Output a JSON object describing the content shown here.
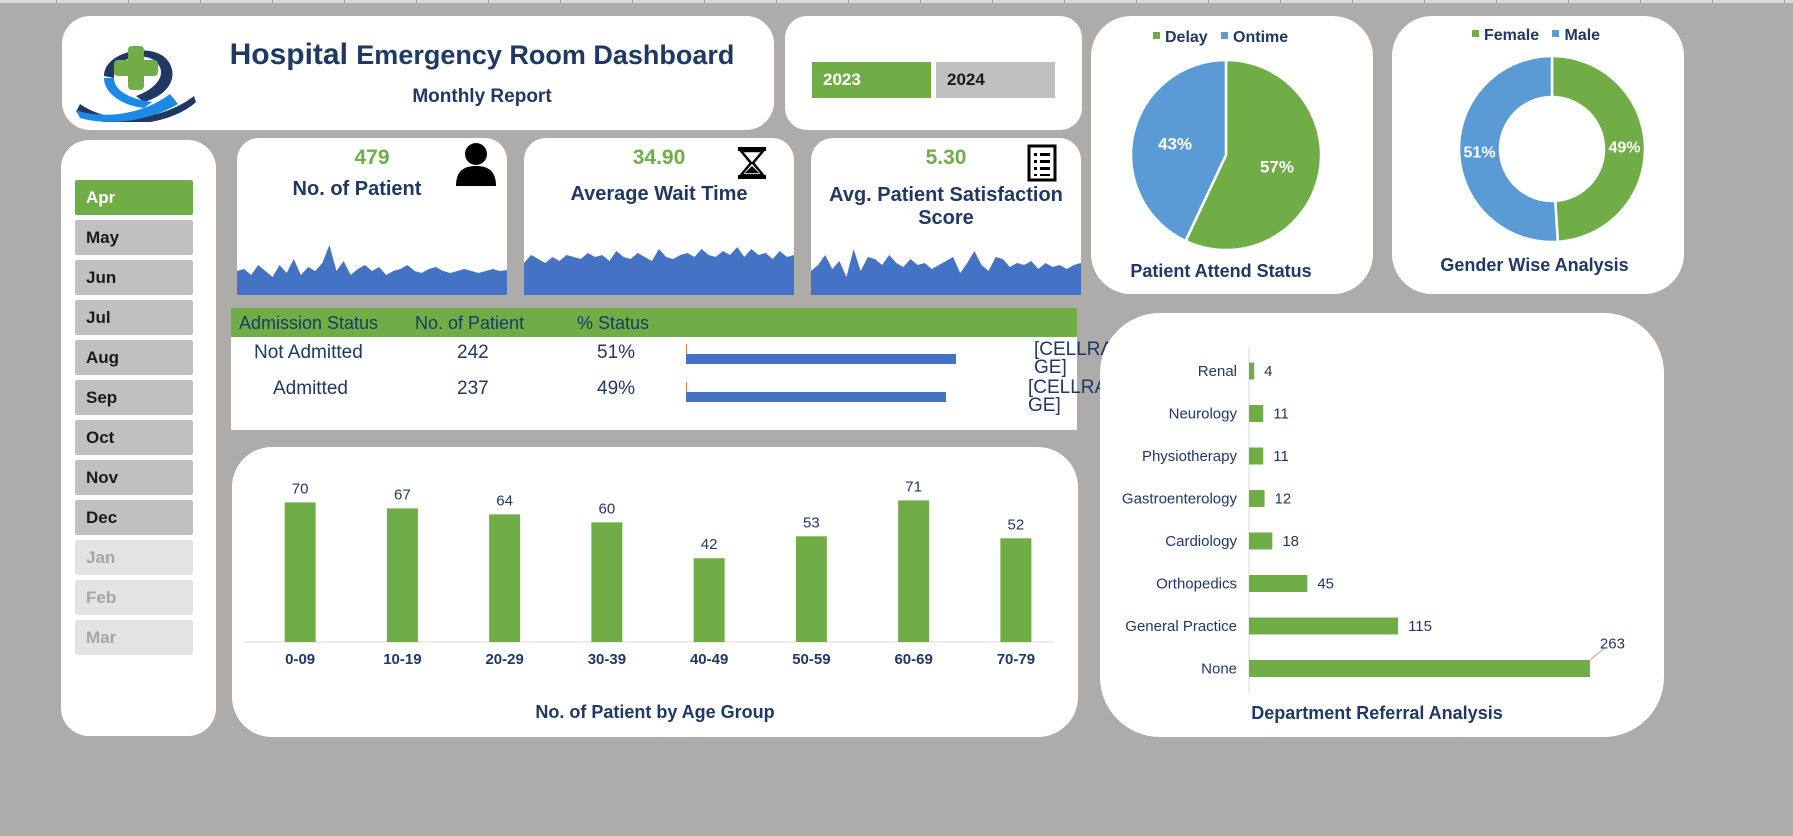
{
  "header": {
    "title_part1": "Hospital",
    "title_part2": "Emergency Room Dashboard",
    "subtitle": "Monthly Report"
  },
  "logo": {
    "icon": "medical-cross-ribbon-logo",
    "colors": {
      "cross": "#70ad47",
      "ribbon_dark": "#1f3864",
      "ribbon_light": "#1e88e5"
    }
  },
  "years": [
    {
      "label": "2023",
      "selected": true
    },
    {
      "label": "2024",
      "selected": false
    }
  ],
  "months": [
    {
      "label": "Apr",
      "state": "selected"
    },
    {
      "label": "May",
      "state": "normal"
    },
    {
      "label": "Jun",
      "state": "normal"
    },
    {
      "label": "Jul",
      "state": "normal"
    },
    {
      "label": "Aug",
      "state": "normal"
    },
    {
      "label": "Sep",
      "state": "normal"
    },
    {
      "label": "Oct",
      "state": "normal"
    },
    {
      "label": "Nov",
      "state": "normal"
    },
    {
      "label": "Dec",
      "state": "normal"
    },
    {
      "label": "Jan",
      "state": "disabled"
    },
    {
      "label": "Feb",
      "state": "disabled"
    },
    {
      "label": "Mar",
      "state": "disabled"
    }
  ],
  "kpis": {
    "patients": {
      "value": "479",
      "label": "No. of Patient",
      "icon": "person-icon"
    },
    "wait": {
      "value": "34.90",
      "label": "Average Wait Time",
      "icon": "hourglass-icon"
    },
    "satisfaction": {
      "value": "5.30",
      "label_line1": "Avg. Patient Satisfaction",
      "label_line2": "Score",
      "icon": "checklist-icon"
    }
  },
  "admission": {
    "headers": [
      "Admission Status",
      "No. of Patient",
      "% Status"
    ],
    "rows": [
      {
        "status": "Not Admitted",
        "count": "242",
        "pct": "51%",
        "pct_value": 0.51,
        "cell_l1": "[CELLRAN",
        "cell_l2": "GE]"
      },
      {
        "status": "Admitted",
        "count": "237",
        "pct": "49%",
        "pct_value": 0.49,
        "cell_l1": "[CELLRAN",
        "cell_l2": "GE]"
      }
    ]
  },
  "colors": {
    "green": "#70ad47",
    "navy": "#1f3864",
    "blue": "#4472c4",
    "pie_blue": "#5b9bd5"
  },
  "chart_data": [
    {
      "type": "bar",
      "title": "No. of Patient by Age Group",
      "categories": [
        "0-09",
        "10-19",
        "20-29",
        "30-39",
        "40-49",
        "50-59",
        "60-69",
        "70-79"
      ],
      "values": [
        70,
        67,
        64,
        60,
        42,
        53,
        71,
        52
      ],
      "ylim": [
        0,
        80
      ],
      "grid": false
    },
    {
      "type": "pie",
      "title": "Patient Attend Status",
      "categories": [
        "Delay",
        "Ontime"
      ],
      "values": [
        57,
        43
      ],
      "labels": [
        "57%",
        "43%"
      ],
      "legend": "top"
    },
    {
      "type": "pie",
      "variant": "donut",
      "title": "Gender Wise Analysis",
      "categories": [
        "Female",
        "Male"
      ],
      "values": [
        49,
        51
      ],
      "labels": [
        "49%",
        "51%"
      ],
      "legend": "top"
    },
    {
      "type": "bar",
      "orientation": "horizontal",
      "title": "Department Referral Analysis",
      "categories": [
        "Renal",
        "Neurology",
        "Physiotherapy",
        "Gastroenterology",
        "Cardiology",
        "Orthopedics",
        "General Practice",
        "None"
      ],
      "values": [
        4,
        11,
        11,
        12,
        18,
        45,
        115,
        263
      ],
      "xlim": [
        0,
        270
      ]
    }
  ]
}
